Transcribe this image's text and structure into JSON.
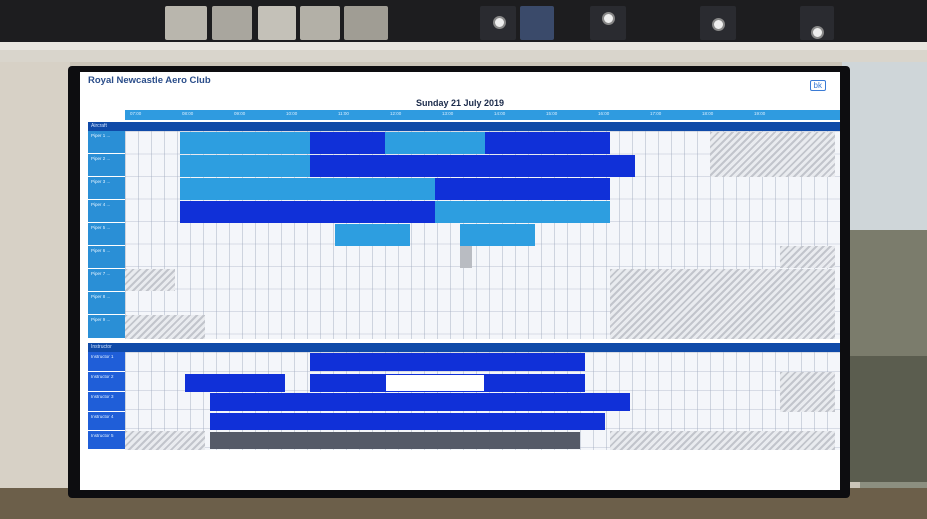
{
  "screen": {
    "club_name": "Royal Newcastle Aero Club",
    "logo_text": "bk",
    "date_title": "Sunday 21 July 2019",
    "time_labels": [
      "07:00",
      "08:00",
      "09:00",
      "10:00",
      "11:00",
      "12:00",
      "13:00",
      "14:00",
      "15:00",
      "16:00",
      "17:00",
      "18:00",
      "19:00"
    ],
    "sections": {
      "aircraft": "Aircraft",
      "instructors": "Instructor"
    },
    "aircraft_rows": [
      "Piper 1 ...",
      "Piper 2 ...",
      "Piper 3 ...",
      "Piper 4 ...",
      "Piper 5 ...",
      "Piper 6 ...",
      "Piper 7 ...",
      "Piper 8 ...",
      "Piper 9 ..."
    ],
    "instructor_rows": [
      "Instructor 1",
      "Instructor 2",
      "Instructor 3",
      "Instructor 4",
      "Instructor 5"
    ],
    "accent_colors": {
      "time_bar": "#2f9be0",
      "section_bar": "#0f4aa8",
      "booking_dark": "#1030d8",
      "booking_light": "#2d9ee0",
      "booking_gray": "#555a68"
    }
  }
}
